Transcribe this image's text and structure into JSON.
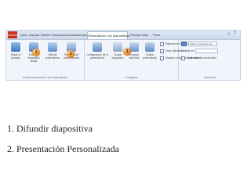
{
  "ribbon": {
    "tabs": [
      "Archivo",
      "Inicio",
      "Insertar",
      "Diseño",
      "Transiciones",
      "Animaciones",
      "Presentación con diapositivas",
      "Revisar",
      "Vista",
      "Prezi"
    ],
    "active_tab": "Presentación con diapositivas",
    "groups": {
      "iniciar": {
        "label": "Iniciar presentación con diapositivas",
        "buttons": [
          "Desde el principio",
          "Desde la diapositiva actual",
          "Difundir presentación",
          "Presentación personalizada"
        ]
      },
      "configurar": {
        "label": "Configurar",
        "buttons": [
          "Configuración de la presentación",
          "Ocultar diapositiva",
          "Ensayar intervalos",
          "Grabar presentación"
        ],
        "options": [
          "Reproducir narraciones",
          "Usar intervalos",
          "Mostrar controles multimedia"
        ]
      },
      "monitores": {
        "label": "Monitores",
        "resolution_label": "Utilizar resolución act...",
        "show_on_label": "Mostrar en:",
        "presenter_view_label": "Usar vista del moderador"
      }
    },
    "colors": {
      "file_tab": "#c7331f",
      "marker": "#e8861c"
    }
  },
  "markers": [
    "1",
    "2",
    "3"
  ],
  "items": [
    "1. Difundir diapositiva",
    "2. Presentación Personalizada"
  ]
}
